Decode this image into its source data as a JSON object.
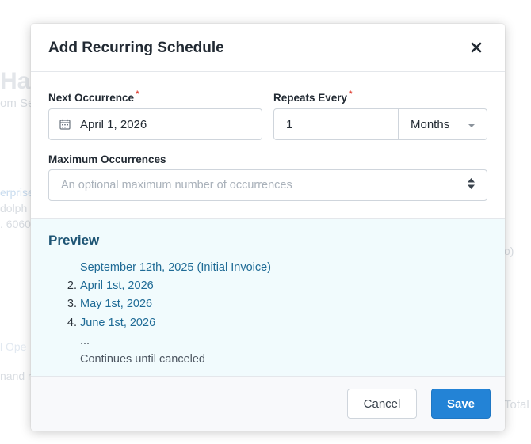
{
  "background": {
    "title_fragment": "Har",
    "subtitle_fragment": "om Se",
    "link1": "erprise",
    "link2": "dolph",
    "link3": ". 6060",
    "right_fragment": "o)",
    "link4": "l Ope",
    "text5": "nand r",
    "total_fragment": "Total"
  },
  "modal": {
    "title": "Add Recurring Schedule",
    "close_icon": "close-icon"
  },
  "form": {
    "next_occurrence": {
      "label": "Next Occurrence",
      "required_marker": "*",
      "value": "April 1, 2026",
      "icon": "calendar-icon"
    },
    "repeats_every": {
      "label": "Repeats Every",
      "required_marker": "*",
      "value": "1",
      "unit": "Months",
      "unit_icon": "caret-down-icon"
    },
    "max_occurrences": {
      "label": "Maximum Occurrences",
      "placeholder": "An optional maximum number of occurrences",
      "value": "",
      "icon": "stepper-icon"
    }
  },
  "preview": {
    "title": "Preview",
    "initial": "September 12th, 2025 (Initial Invoice)",
    "items": [
      {
        "num": "2.",
        "date": "April 1st, 2026"
      },
      {
        "num": "3.",
        "date": "May 1st, 2026"
      },
      {
        "num": "4.",
        "date": "June 1st, 2026"
      }
    ],
    "ellipsis": "...",
    "continues": "Continues until canceled"
  },
  "footer": {
    "cancel_label": "Cancel",
    "save_label": "Save"
  },
  "colors": {
    "accent": "#2383d6",
    "link": "#1f6b96",
    "preview_bg": "#f1fbfd",
    "required": "#e0463a"
  }
}
